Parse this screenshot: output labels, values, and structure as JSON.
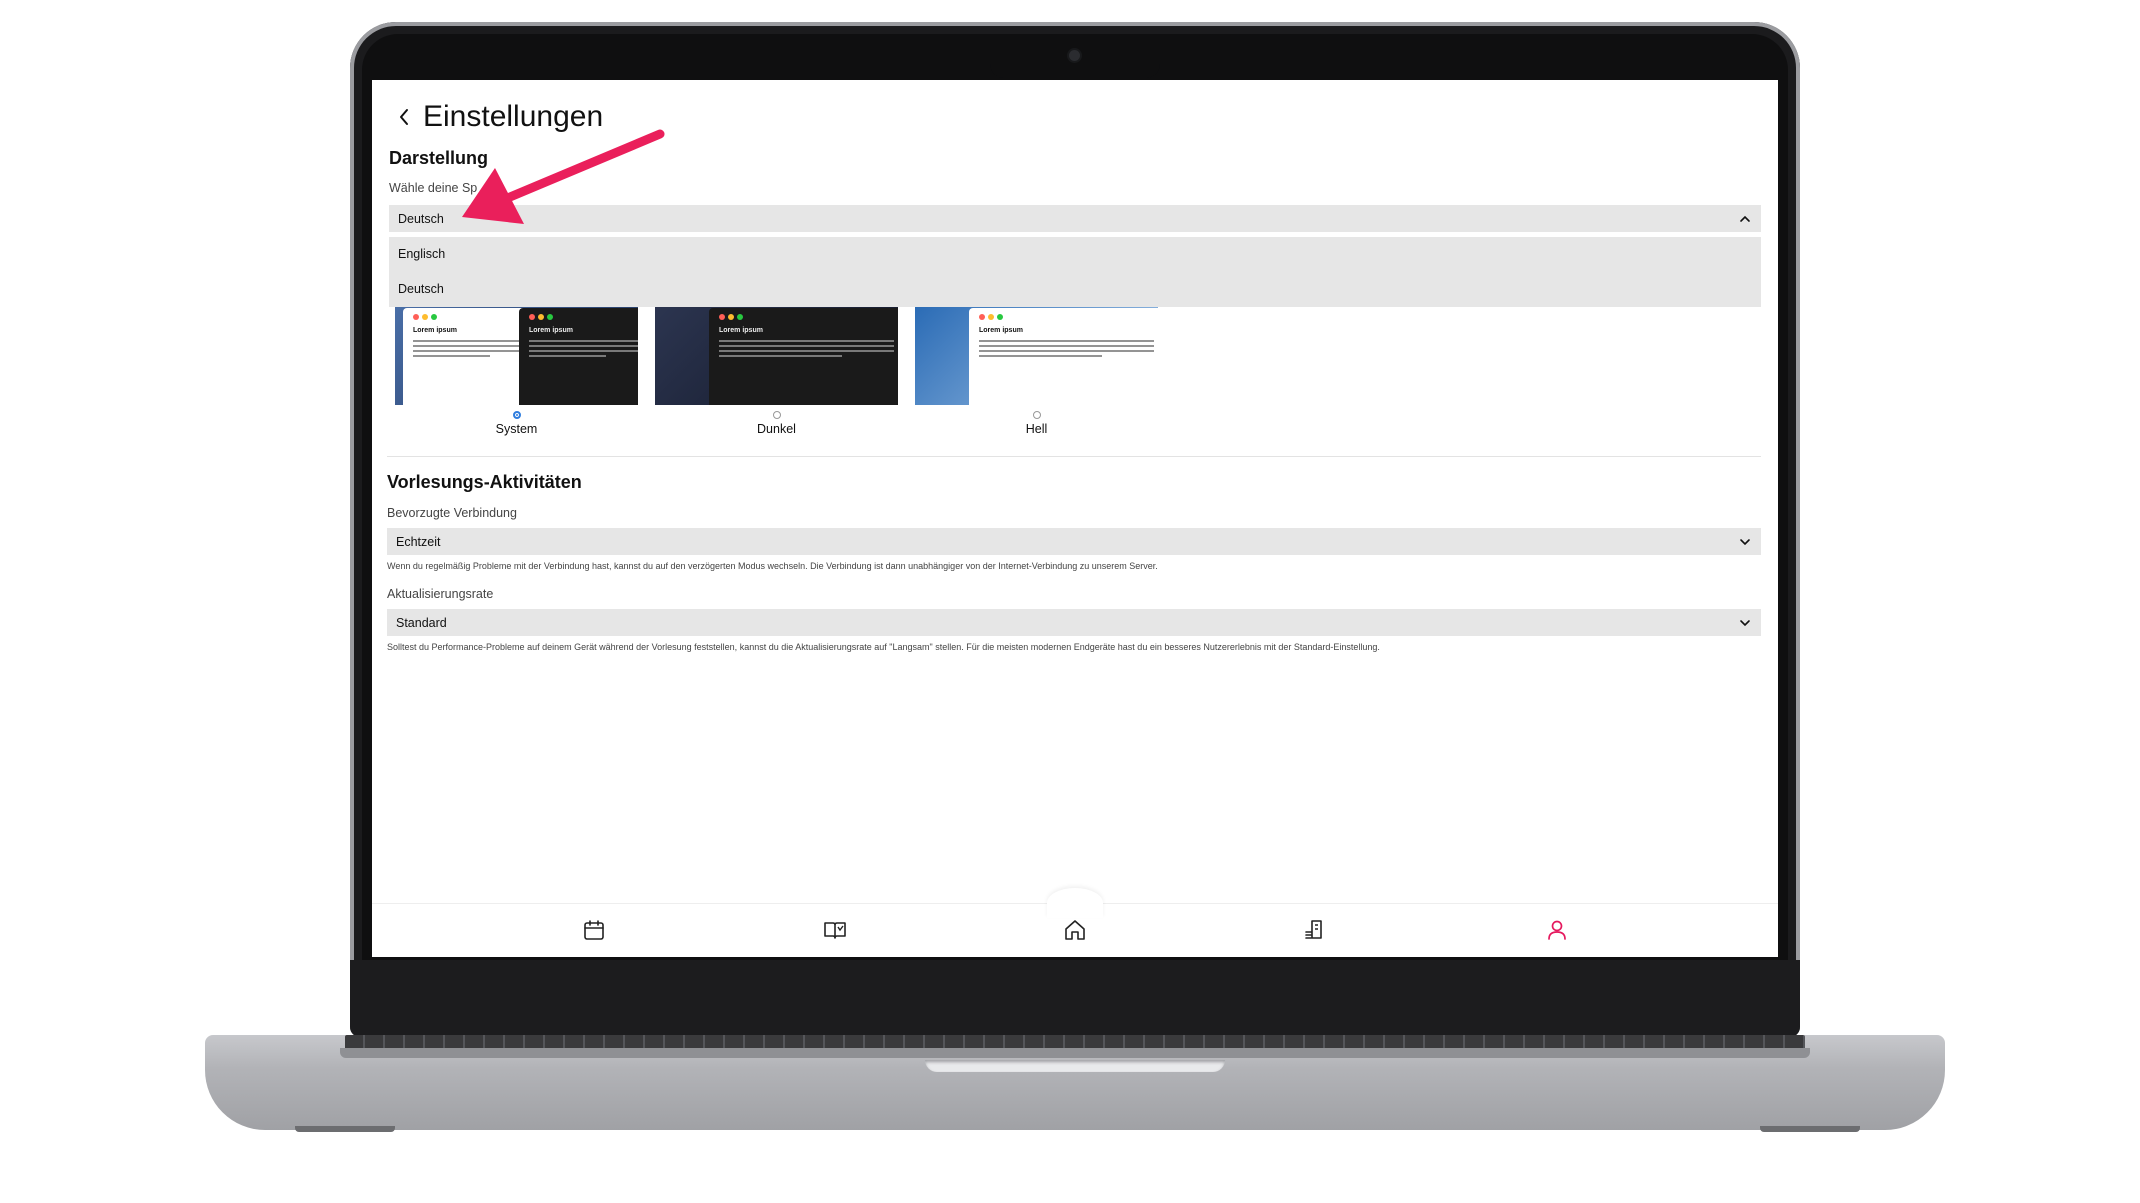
{
  "page": {
    "title": "Einstellungen"
  },
  "darstellung": {
    "section_title": "Darstellung",
    "language_label": "Wähle deine Sp",
    "language_selected": "Deutsch",
    "language_options": [
      "Englisch",
      "Deutsch"
    ],
    "themes": [
      {
        "label": "System",
        "selected": true
      },
      {
        "label": "Dunkel",
        "selected": false
      },
      {
        "label": "Hell",
        "selected": false
      }
    ],
    "preview_title": "Lorem ipsum"
  },
  "vorlesung": {
    "section_title": "Vorlesungs-Aktivitäten",
    "connection_label": "Bevorzugte Verbindung",
    "connection_value": "Echtzeit",
    "connection_help": "Wenn du regelmäßig Probleme mit der Verbindung hast, kannst du auf den verzögerten Modus wechseln. Die Verbindung ist dann unabhängiger von der Internet-Verbindung zu unserem Server.",
    "rate_label": "Aktualisierungsrate",
    "rate_value": "Standard",
    "rate_help": "Solltest du Performance-Probleme auf deinem Gerät während der Vorlesung feststellen, kannst du die Aktualisierungsrate auf \"Langsam\" stellen. Für die meisten modernen Endgeräte hast du ein besseres Nutzererlebnis mit der Standard-Einstellung."
  },
  "nav": {
    "items": [
      "calendar-icon",
      "book-icon",
      "home-icon",
      "notes-icon",
      "profile-icon"
    ],
    "active": "profile-icon"
  },
  "colors": {
    "accent": "#e5195e",
    "annotation_arrow": "#ea1f5b",
    "radio_selected": "#2f7dde"
  }
}
